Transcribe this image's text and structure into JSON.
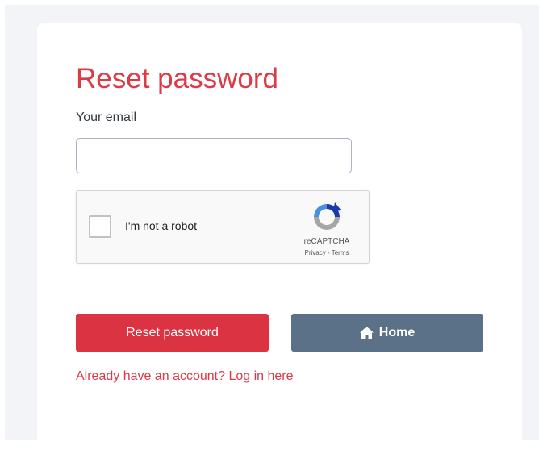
{
  "form": {
    "title": "Reset password",
    "email_label": "Your email",
    "email_value": "",
    "submit_label": "Reset password",
    "home_label": "Home",
    "home_icon": "home-icon",
    "login_link": "Already have an account? Log in here"
  },
  "captcha": {
    "label": "I'm not a robot",
    "brand": "reCAPTCHA",
    "privacy": "Privacy",
    "separator": " - ",
    "terms": "Terms",
    "logo_icon": "recaptcha-logo-icon"
  },
  "colors": {
    "accent": "#db3341",
    "secondary": "#5a7187",
    "background": "#f2f4f7"
  }
}
